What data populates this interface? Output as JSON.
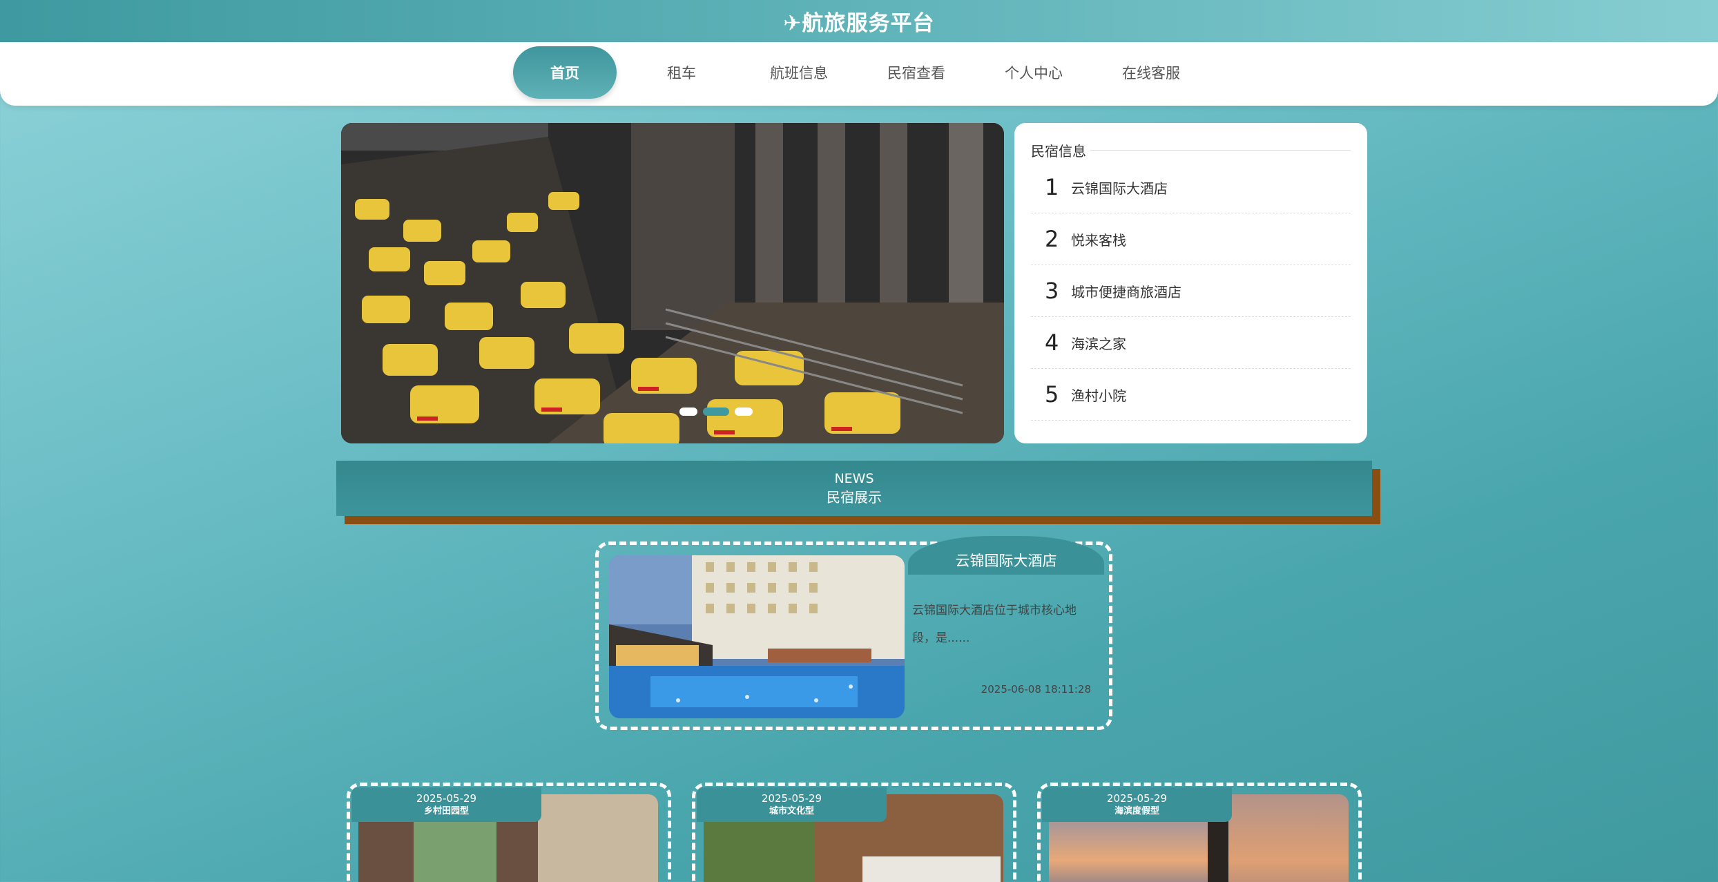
{
  "header": {
    "title": "✈航旅服务平台"
  },
  "nav": {
    "items": [
      {
        "label": "首页",
        "active": true
      },
      {
        "label": "租车",
        "active": false
      },
      {
        "label": "航班信息",
        "active": false
      },
      {
        "label": "民宿查看",
        "active": false
      },
      {
        "label": "个人中心",
        "active": false
      },
      {
        "label": "在线客服",
        "active": false
      }
    ]
  },
  "banner": {
    "image": "airport taxi queue photo",
    "slides": 3,
    "active_slide": 2
  },
  "homestay_panel": {
    "title": "民宿信息",
    "items": [
      {
        "rank": "1",
        "name": "云锦国际大酒店"
      },
      {
        "rank": "2",
        "name": "悦来客栈"
      },
      {
        "rank": "3",
        "name": "城市便捷商旅酒店"
      },
      {
        "rank": "4",
        "name": "海滨之家"
      },
      {
        "rank": "5",
        "name": "渔村小院"
      }
    ]
  },
  "news": {
    "en": "NEWS",
    "cn": "民宿展示"
  },
  "featured": {
    "title": "云锦国际大酒店",
    "description": "云锦国际大酒店位于城市核心地段，是......",
    "date": "2025-06-08 18:11:28",
    "image": "hotel pool photo"
  },
  "cards": [
    {
      "date": "2025-05-29",
      "type": "乡村田园型",
      "image": "rustic room photo"
    },
    {
      "date": "2025-05-29",
      "type": "城市文化型",
      "image": "wooden bedroom photo"
    },
    {
      "date": "2025-05-29",
      "type": "海滨度假型",
      "image": "seaside sunset photo"
    }
  ],
  "colors": {
    "primary": "#3f999f",
    "accent": "#8a4d12"
  }
}
